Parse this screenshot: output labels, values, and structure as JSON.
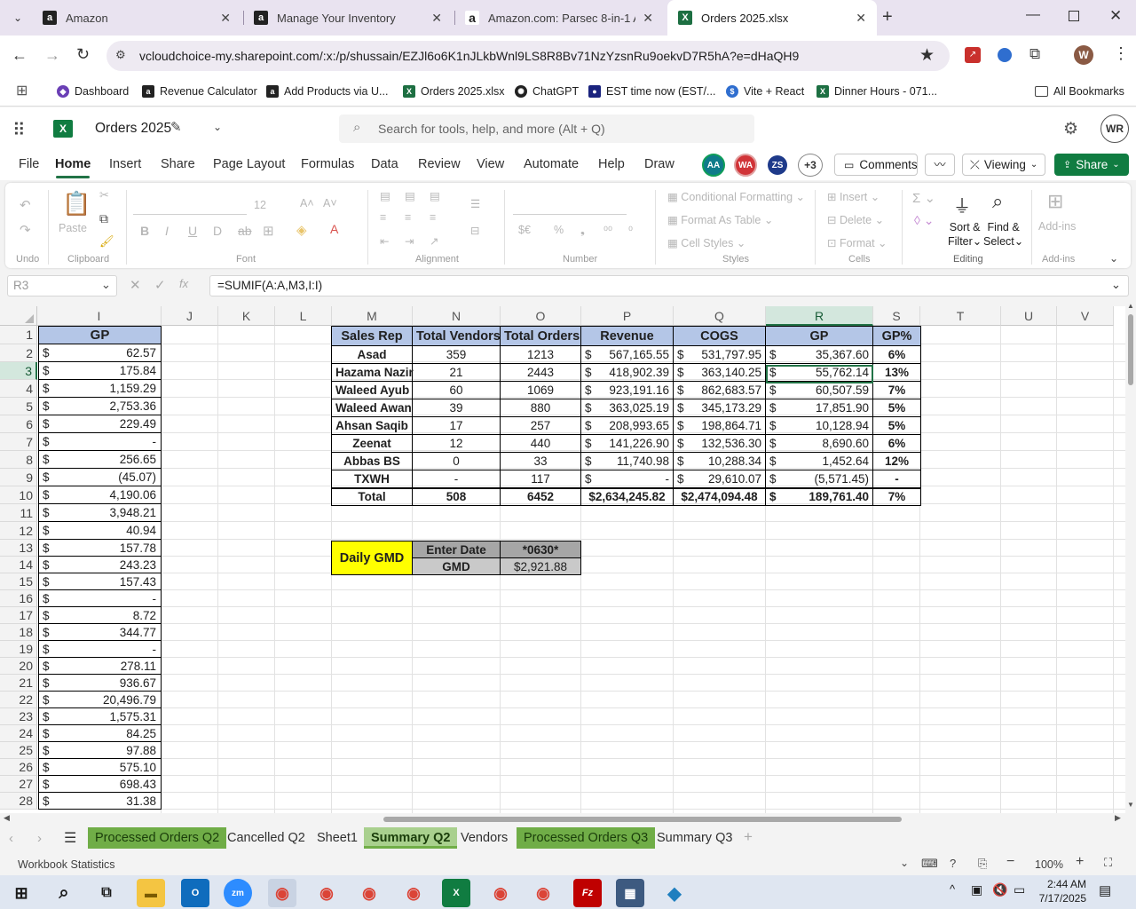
{
  "browser": {
    "tabs": [
      {
        "title": "Amazon",
        "icon": "amazon-icon"
      },
      {
        "title": "Manage Your Inventory",
        "icon": "amazon-icon"
      },
      {
        "title": "Amazon.com: Parsec 8-in-1 Aus",
        "icon": "amazon-icon"
      },
      {
        "title": "Orders 2025.xlsx",
        "icon": "excel-icon",
        "active": true
      }
    ],
    "url": "vcloudchoice-my.sharepoint.com/:x:/p/shussain/EZJl6o6K1nJLkbWnl9LS8R8Bv71NzYzsnRu9oekvD7R5hA?e=dHaQH9",
    "bookmarks": [
      {
        "label": "Dashboard"
      },
      {
        "label": "Revenue Calculator"
      },
      {
        "label": "Add Products via U..."
      },
      {
        "label": "Orders 2025.xlsx"
      },
      {
        "label": "ChatGPT"
      },
      {
        "label": "EST time now (EST/..."
      },
      {
        "label": "Vite + React"
      },
      {
        "label": "Dinner Hours - 071..."
      }
    ],
    "all_bookmarks": "All Bookmarks",
    "profile_initial": "W"
  },
  "excel": {
    "doc_title": "Orders 2025",
    "search_placeholder": "Search for tools, help, and more (Alt + Q)",
    "user_initials": "WR",
    "menu": [
      "File",
      "Home",
      "Insert",
      "Share",
      "Page Layout",
      "Formulas",
      "Data",
      "Review",
      "View",
      "Automate",
      "Help",
      "Draw"
    ],
    "active_menu": "Home",
    "collaborators": [
      "AA",
      "WA",
      "ZS"
    ],
    "collab_more": "+3",
    "comments_label": "Comments",
    "viewing_label": "Viewing",
    "share_label": "Share",
    "ribbon": {
      "undo": "Undo",
      "paste": "Paste",
      "clipboard": "Clipboard",
      "font_size": "12",
      "font": "Font",
      "alignment": "Alignment",
      "number": "Number",
      "conditional_formatting": "Conditional Formatting",
      "format_as_table": "Format As Table",
      "cell_styles": "Cell Styles",
      "styles": "Styles",
      "insert": "Insert",
      "delete": "Delete",
      "format": "Format",
      "cells": "Cells",
      "sort_filter_1": "Sort &",
      "sort_filter_2": "Filter",
      "find_select_1": "Find &",
      "find_select_2": "Select",
      "editing": "Editing",
      "addins": "Add-ins",
      "addins_group": "Add-ins"
    },
    "name_box": "R3",
    "formula": "=SUMIF(A:A,M3,I:I)",
    "columns": [
      "I",
      "J",
      "K",
      "L",
      "M",
      "N",
      "O",
      "P",
      "Q",
      "R",
      "S",
      "T",
      "U",
      "V"
    ],
    "selected_column": "R",
    "selected_row": "3",
    "gp_header": "GP",
    "gp_values": [
      "62.57",
      "175.84",
      "1,159.29",
      "2,753.36",
      "229.49",
      "-",
      "256.65",
      "(45.07)",
      "4,190.06",
      "3,948.21",
      "40.94",
      "157.78",
      "243.23",
      "157.43",
      "-",
      "8.72",
      "344.77",
      "-",
      "278.11",
      "936.67",
      "20,496.79",
      "1,575.31",
      "84.25",
      "97.88",
      "575.10",
      "698.43",
      "31.38"
    ],
    "currency": "$",
    "summary": {
      "headers": [
        "Sales Rep",
        "Total Vendors",
        "Total Orders",
        "Revenue",
        "COGS",
        "GP",
        "GP%"
      ],
      "rows": [
        {
          "rep": "Asad",
          "vendors": "359",
          "orders": "1213",
          "revenue": "567,165.55",
          "cogs": "531,797.95",
          "gp": "35,367.60",
          "gpp": "6%"
        },
        {
          "rep": "Hazama Nazir",
          "vendors": "21",
          "orders": "2443",
          "revenue": "418,902.39",
          "cogs": "363,140.25",
          "gp": "55,762.14",
          "gpp": "13%"
        },
        {
          "rep": "Waleed Ayub",
          "vendors": "60",
          "orders": "1069",
          "revenue": "923,191.16",
          "cogs": "862,683.57",
          "gp": "60,507.59",
          "gpp": "7%"
        },
        {
          "rep": "Waleed Awan",
          "vendors": "39",
          "orders": "880",
          "revenue": "363,025.19",
          "cogs": "345,173.29",
          "gp": "17,851.90",
          "gpp": "5%"
        },
        {
          "rep": "Ahsan Saqib",
          "vendors": "17",
          "orders": "257",
          "revenue": "208,993.65",
          "cogs": "198,864.71",
          "gp": "10,128.94",
          "gpp": "5%"
        },
        {
          "rep": "Zeenat",
          "vendors": "12",
          "orders": "440",
          "revenue": "141,226.90",
          "cogs": "132,536.30",
          "gp": "8,690.60",
          "gpp": "6%"
        },
        {
          "rep": "Abbas BS",
          "vendors": "0",
          "orders": "33",
          "revenue": "11,740.98",
          "cogs": "10,288.34",
          "gp": "1,452.64",
          "gpp": "12%"
        },
        {
          "rep": "TXWH",
          "vendors": "-",
          "orders": "117",
          "revenue": "-",
          "cogs": "29,610.07",
          "gp": "(5,571.45)",
          "gpp": "-"
        }
      ],
      "total": {
        "rep": "Total",
        "vendors": "508",
        "orders": "6452",
        "revenue": "$2,634,245.82",
        "cogs": "$2,474,094.48",
        "gp": "189,761.40",
        "gpp": "7%"
      }
    },
    "gmd": {
      "label": "Daily GMD",
      "enter_date_label": "Enter Date",
      "enter_date_value": "*0630*",
      "gmd_label": "GMD",
      "gmd_value": "$2,921.88"
    },
    "sheet_tabs": [
      {
        "label": "Processed Orders Q2",
        "color": "#70ad47"
      },
      {
        "label": "Cancelled Q2"
      },
      {
        "label": "Sheet1"
      },
      {
        "label": "Summary Q2",
        "color": "#70ad47",
        "active": true
      },
      {
        "label": "Vendors"
      },
      {
        "label": "Processed Orders Q3",
        "color": "#70ad47"
      },
      {
        "label": "Summary Q3"
      }
    ],
    "status_left": "Workbook Statistics",
    "zoom": "100%"
  },
  "taskbar": {
    "time": "2:44 AM",
    "date": "7/17/2025"
  },
  "colors": {
    "excel_green": "#217346",
    "header_fill": "#b4c6e7",
    "gmd_yellow": "#ffff00",
    "gmd_gray": "#a6a6a6",
    "tab_green": "#70ad47"
  }
}
